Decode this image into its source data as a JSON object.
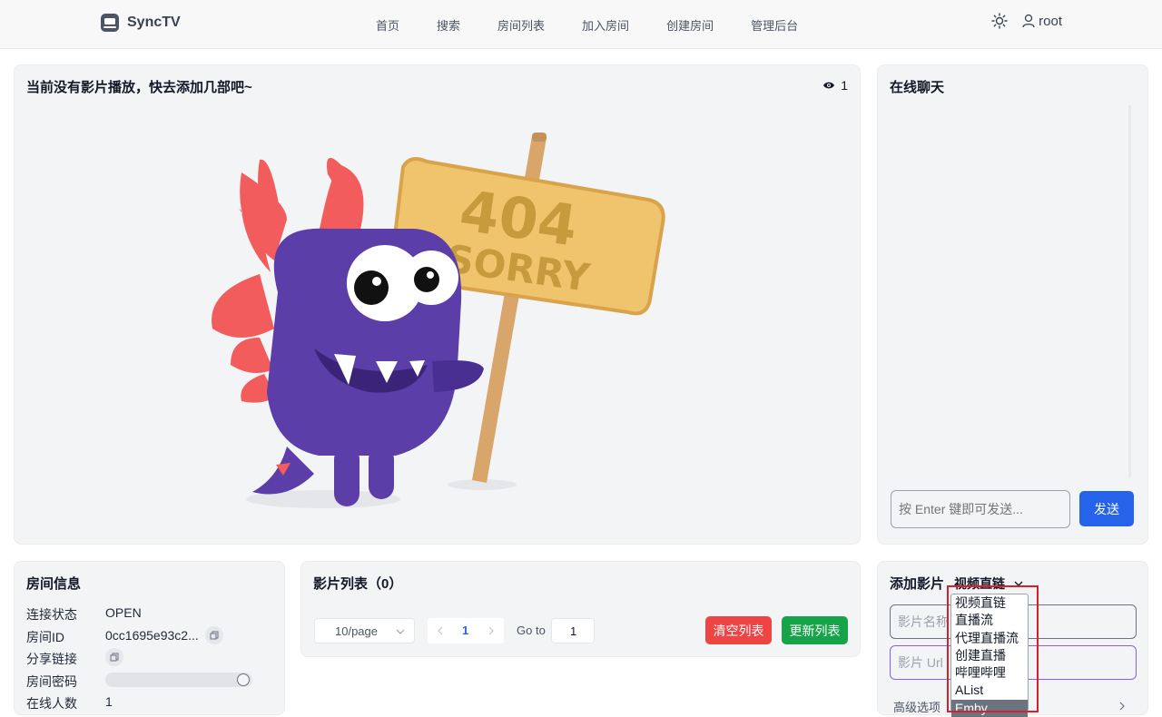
{
  "brand": {
    "name": "SyncTV"
  },
  "nav": {
    "items": [
      "首页",
      "搜索",
      "房间列表",
      "加入房间",
      "创建房间",
      "管理后台"
    ]
  },
  "user": {
    "name": "root"
  },
  "player": {
    "title": "当前没有影片播放，快去添加几部吧~",
    "viewer_count": "1",
    "sign_top": "404",
    "sign_bottom": "SORRY"
  },
  "chat": {
    "title": "在线聊天",
    "placeholder": "按 Enter 键即可发送...",
    "send_label": "发送"
  },
  "room_info": {
    "title": "房间信息",
    "rows": [
      {
        "label": "连接状态",
        "value": "OPEN"
      },
      {
        "label": "房间ID",
        "value": "0cc1695e93c2..."
      },
      {
        "label": "分享链接",
        "value": ""
      },
      {
        "label": "房间密码",
        "value": ""
      },
      {
        "label": "在线人数",
        "value": "1"
      }
    ]
  },
  "movie_list": {
    "title": "影片列表（0）",
    "page_size": "10/page",
    "current_page": "1",
    "goto_label": "Go to",
    "goto_value": "1",
    "clear_label": "清空列表",
    "update_label": "更新列表"
  },
  "add_movie": {
    "title": "添加影片",
    "type_selected": "视频直链",
    "name_placeholder": "影片名称",
    "url_placeholder": "影片 Url",
    "advanced_label": "高级选项",
    "options": [
      "视频直链",
      "直播流",
      "代理直播流",
      "创建直播",
      "哔哩哔哩",
      "AList",
      "Emby"
    ],
    "selected_option": "Emby"
  },
  "colors": {
    "primary": "#2563eb",
    "danger": "#ef4444",
    "success": "#16a34a",
    "accent_purple": "#8b5cf6",
    "monster": "#5b3ea8",
    "sign": "#f0c46c",
    "highlight": "#d8202a"
  }
}
